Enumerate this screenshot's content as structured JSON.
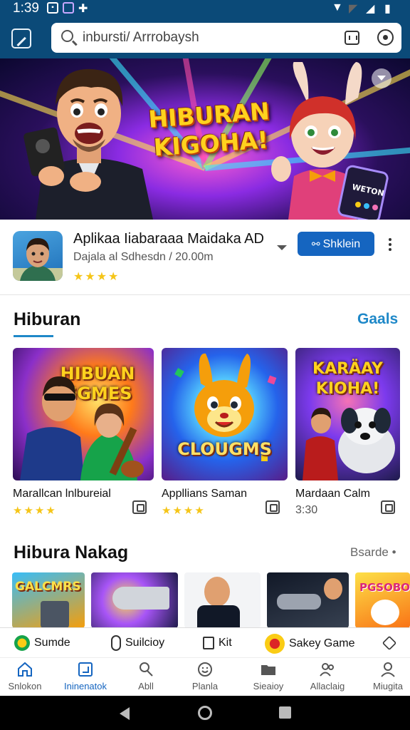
{
  "status_bar": {
    "time": "1:39"
  },
  "search": {
    "placeholder": "inbursti/ Arrrobaysh"
  },
  "hero": {
    "title": "HIBURAN KIGOHA!",
    "phone_label": "WETON"
  },
  "featured_app": {
    "title": "Aplikaa Iiabaraaa Maidaka AD",
    "subtitle": "Dajala al Sdhesdn / 20.00m",
    "rating": "★★★★",
    "install_label": "Shklein"
  },
  "section1": {
    "title": "Hiburan",
    "link": "Gaals",
    "cards": [
      {
        "name": "Marallcan lnlbureial",
        "rating": "★★★★",
        "thumb_text": "HIBUAN GGMES"
      },
      {
        "name": "Appllians Saman",
        "rating": "★★★★",
        "thumb_text": "CLOUGMS"
      },
      {
        "name": "Mardaan Calm",
        "rating_text": "3:30",
        "thumb_text": "KARÄAY KIOHA!"
      }
    ]
  },
  "section2": {
    "title": "Hibura Nakag",
    "link": "Bsarde •",
    "thumbs": [
      "GALCMRS",
      "",
      "",
      "",
      "PGSOBO"
    ]
  },
  "quick_actions": [
    "Sumde",
    "Suilcioy",
    "Kit",
    "Sakey Game"
  ],
  "bottom_nav": [
    "Snlokon",
    "Ininenatok",
    "Abll",
    "Planla",
    "Sieaioy",
    "Allaclaig",
    "Miugita"
  ],
  "colors": {
    "header": "#0b4a78",
    "accent": "#1565c0",
    "link": "#1e88c8",
    "star": "#f5c518"
  }
}
